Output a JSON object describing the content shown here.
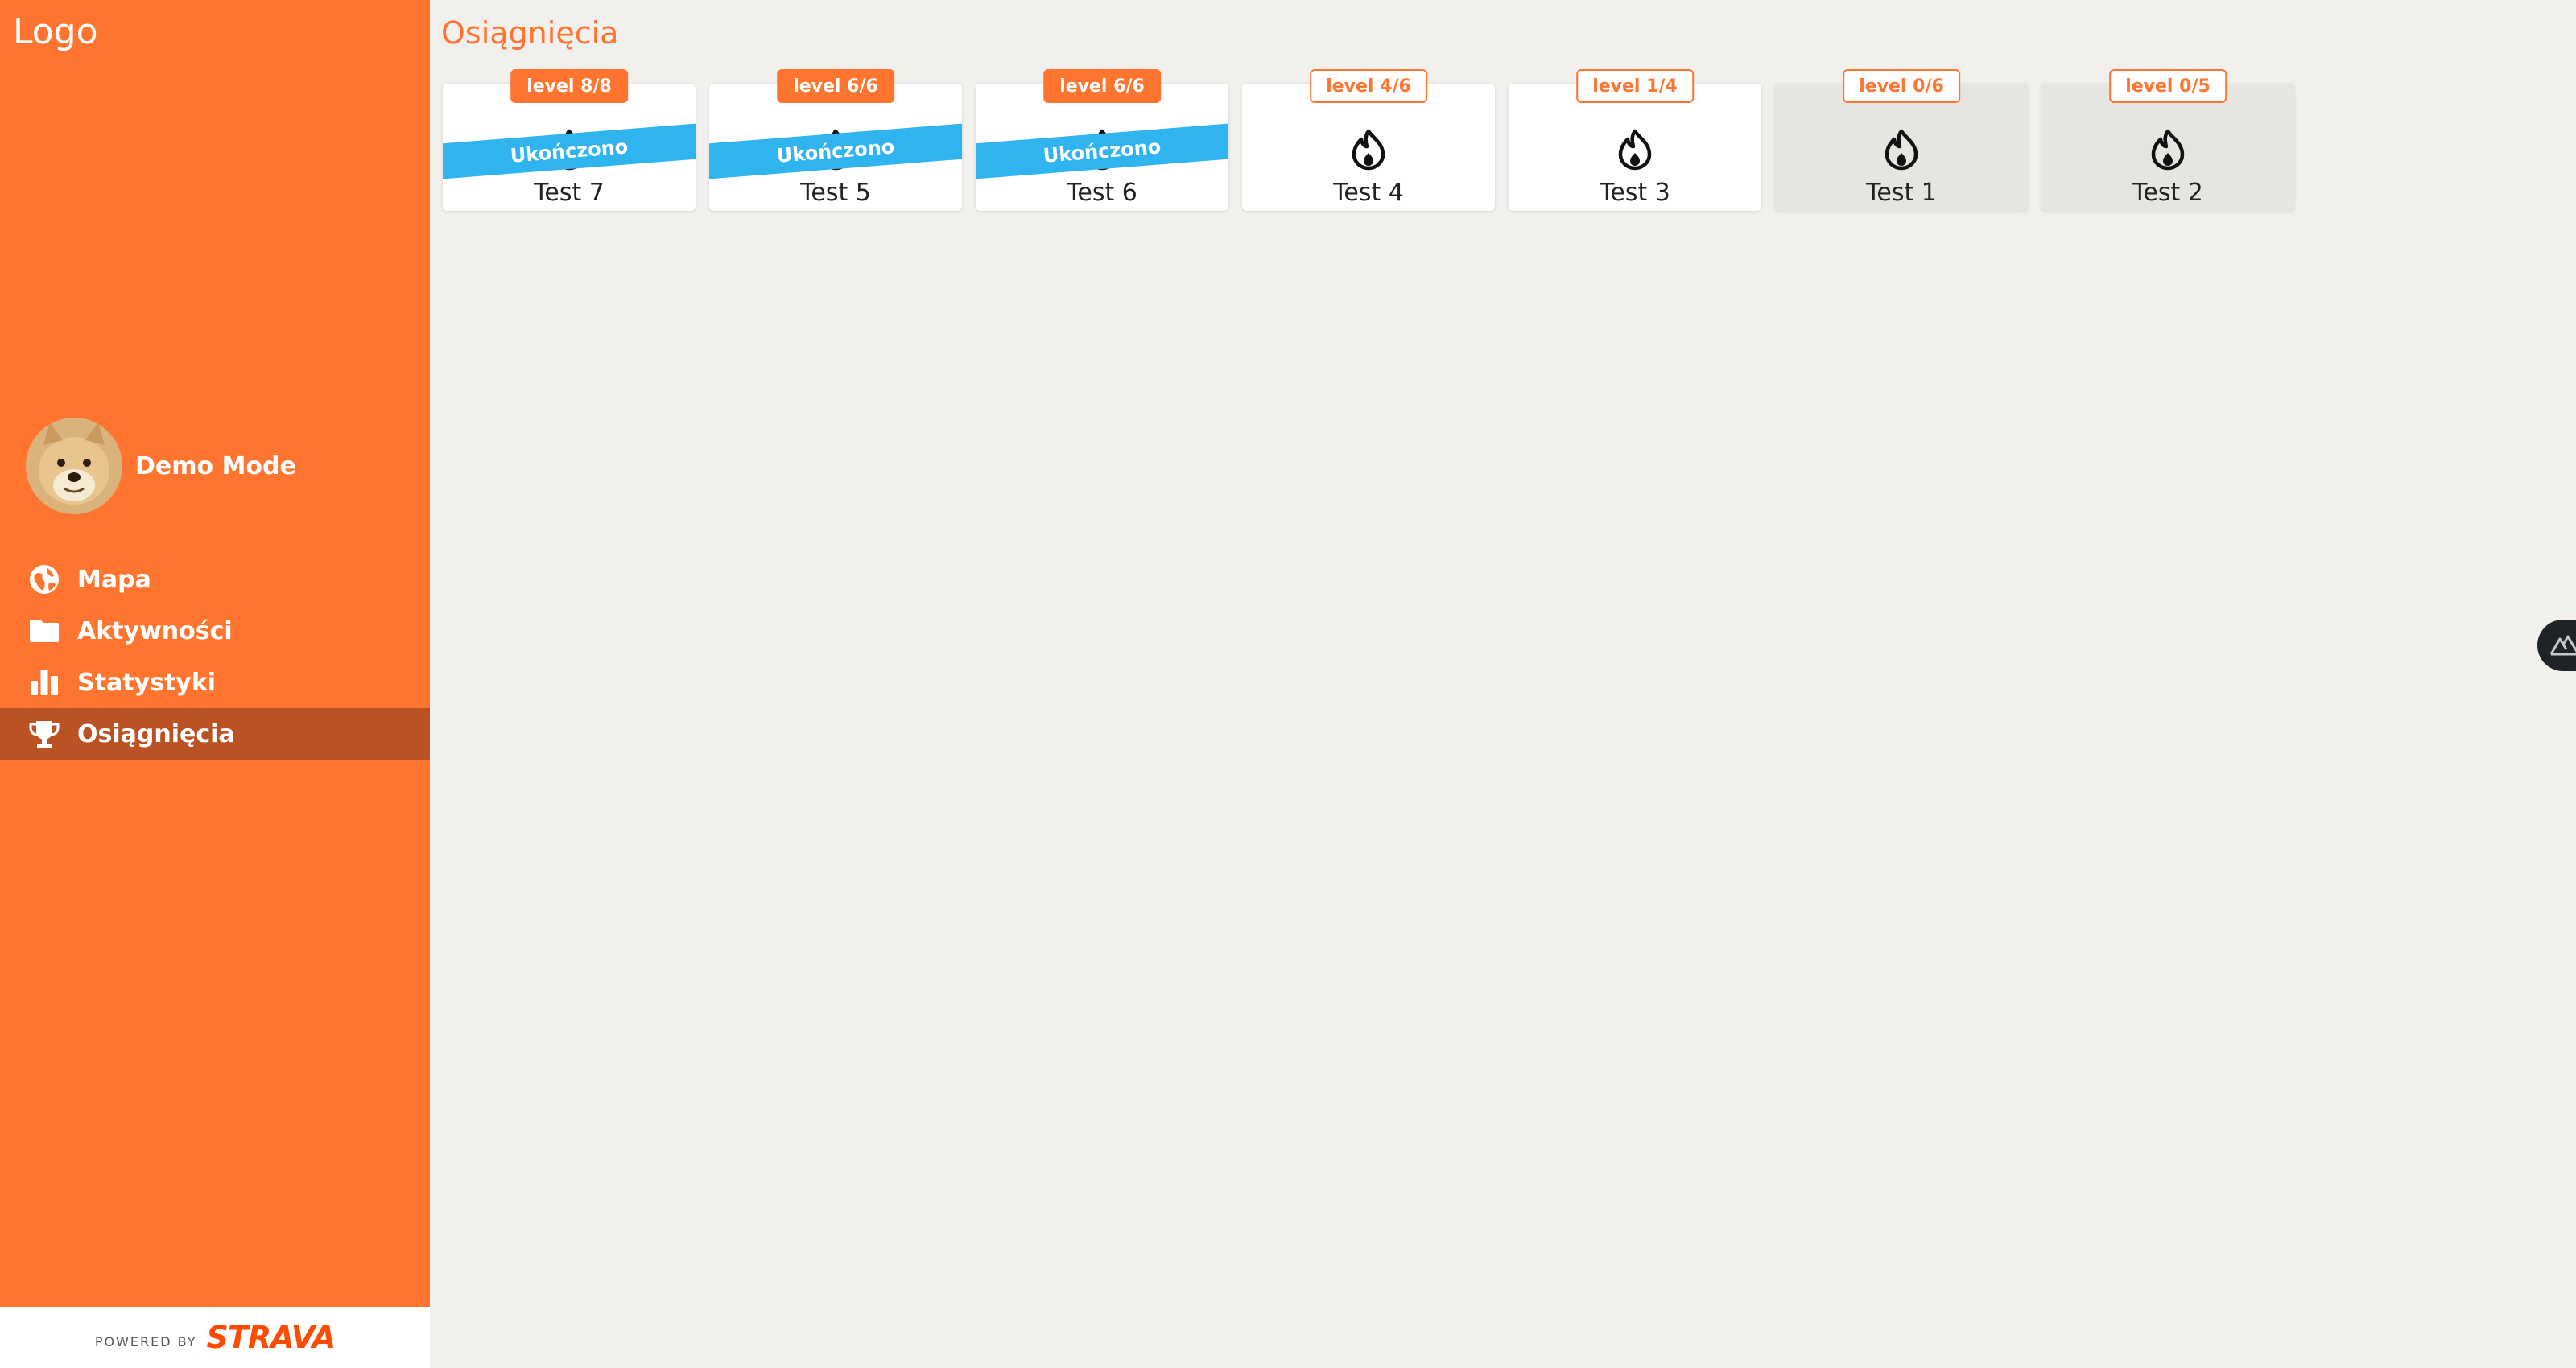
{
  "app": {
    "logo_text": "Logo"
  },
  "profile": {
    "name": "Demo Mode"
  },
  "nav": {
    "items": [
      {
        "label": "Mapa",
        "icon": "globe-icon",
        "active": false
      },
      {
        "label": "Aktywności",
        "icon": "folder-icon",
        "active": false
      },
      {
        "label": "Statystyki",
        "icon": "bar-chart-icon",
        "active": false
      },
      {
        "label": "Osiągnięcia",
        "icon": "trophy-icon",
        "active": true
      }
    ]
  },
  "footer": {
    "powered_by": "POWERED BY",
    "brand": "STRAVA"
  },
  "page": {
    "title": "Osiągnięcia"
  },
  "achievements": [
    {
      "title": "Test 7",
      "level": "level 8/8",
      "completed": true,
      "ribbon": "Ukończono"
    },
    {
      "title": "Test 5",
      "level": "level 6/6",
      "completed": true,
      "ribbon": "Ukończono"
    },
    {
      "title": "Test 6",
      "level": "level 6/6",
      "completed": true,
      "ribbon": "Ukończono"
    },
    {
      "title": "Test 4",
      "level": "level 4/6",
      "completed": false,
      "inactive": false
    },
    {
      "title": "Test 3",
      "level": "level 1/4",
      "completed": false,
      "inactive": false
    },
    {
      "title": "Test 1",
      "level": "level 0/6",
      "completed": false,
      "inactive": true
    },
    {
      "title": "Test 2",
      "level": "level 0/5",
      "completed": false,
      "inactive": true
    }
  ],
  "colors": {
    "accent": "#ff7530",
    "sidebar_active": "#bb5224",
    "ribbon": "#2fb4f0",
    "background": "#f1f0ed",
    "card_inactive": "#e6e5e1"
  }
}
